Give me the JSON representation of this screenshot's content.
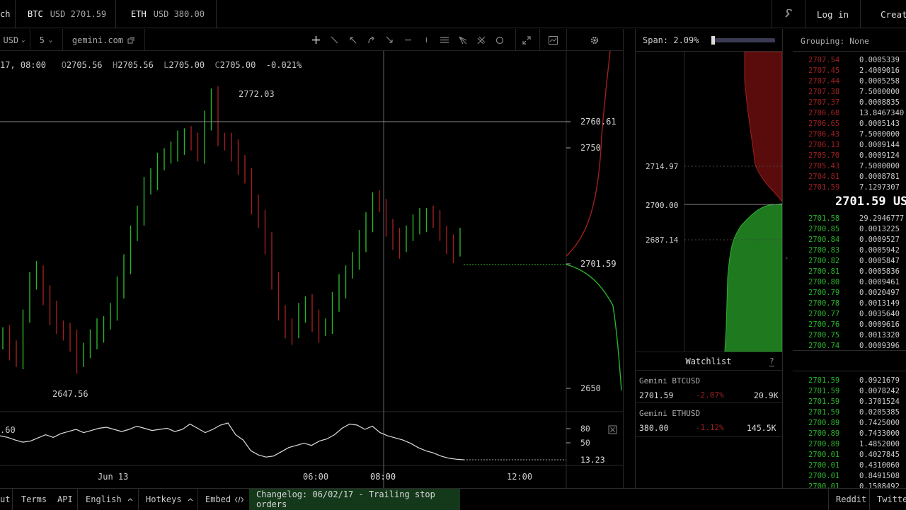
{
  "topbar": {
    "left_fragment": "ch",
    "tickers": [
      {
        "symbol": "BTC",
        "price": "USD 2701.59"
      },
      {
        "symbol": "ETH",
        "price": "USD 380.00"
      }
    ],
    "login": "Log in",
    "create": "Create"
  },
  "toolbar": {
    "pair_fragment": "USD",
    "interval": "5",
    "source": "gemini.com",
    "chevron": "⌄"
  },
  "ohlc": {
    "date": "17, 08:00",
    "open_label": "O",
    "open": "2705.56",
    "high_label": "H",
    "high": "2705.56",
    "low_label": "L",
    "low": "2705.00",
    "close_label": "C",
    "close": "2705.00",
    "change": "-0.021%"
  },
  "chart_data": {
    "type": "candlestick",
    "title": "",
    "x_ticks": [
      "Jun 13",
      "06:00",
      "08:00",
      "12:00"
    ],
    "y_ticks": [
      "2750",
      "2650"
    ],
    "y_range": [
      2630,
      2790
    ],
    "crosshair_price": "2760.61",
    "last_price": "2701.59",
    "high_marker": "2772.03",
    "low_marker": "2647.56",
    "closes": [
      2662,
      2654,
      2652,
      2670,
      2686,
      2690,
      2680,
      2672,
      2665,
      2663,
      2659,
      2650,
      2655,
      2660,
      2664,
      2667,
      2672,
      2683,
      2695,
      2707,
      2715,
      2730,
      2733,
      2739,
      2743,
      2745,
      2749,
      2752,
      2748,
      2744,
      2760,
      2769,
      2750,
      2749,
      2745,
      2740,
      2733,
      2720,
      2715,
      2704,
      2685,
      2672,
      2665,
      2663,
      2671,
      2676,
      2668,
      2664,
      2666,
      2677,
      2684,
      2690,
      2695,
      2704,
      2714,
      2722,
      2720,
      2710,
      2705,
      2702,
      2708,
      2712,
      2714,
      2716,
      2713,
      2708,
      2703,
      2700,
      2705
    ],
    "indicator": {
      "value_fragment": ".60",
      "ticks": [
        "80",
        "50"
      ],
      "last": "13.23",
      "values": [
        58,
        55,
        50,
        46,
        48,
        54,
        60,
        55,
        62,
        66,
        70,
        64,
        68,
        72,
        74,
        70,
        66,
        70,
        76,
        72,
        68,
        70,
        72,
        66,
        70,
        80,
        72,
        64,
        70,
        78,
        82,
        60,
        50,
        30,
        22,
        18,
        20,
        28,
        36,
        40,
        44,
        40,
        48,
        52,
        60,
        72,
        80,
        78,
        70,
        76,
        64,
        58,
        54,
        50,
        44,
        36,
        30,
        26,
        20,
        16,
        14,
        13
      ]
    }
  },
  "depth": {
    "span": "Span: 2.09%",
    "span_fraction": 0.05,
    "prices": [
      "2714.97",
      "2700.00",
      "2687.14"
    ]
  },
  "orderbook": {
    "grouping": "Grouping: None",
    "last_price": "2701.59 US",
    "asks": [
      {
        "price": "2707.54",
        "size": "0.0005339"
      },
      {
        "price": "2707.45",
        "size": "2.4009016"
      },
      {
        "price": "2707.44",
        "size": "0.0005258"
      },
      {
        "price": "2707.38",
        "size": "7.5000000"
      },
      {
        "price": "2707.37",
        "size": "0.0008835"
      },
      {
        "price": "2706.68",
        "size": "13.8467340"
      },
      {
        "price": "2706.65",
        "size": "0.0005143"
      },
      {
        "price": "2706.43",
        "size": "7.5000000"
      },
      {
        "price": "2706.13",
        "size": "0.0009144"
      },
      {
        "price": "2705.70",
        "size": "0.0009124"
      },
      {
        "price": "2705.43",
        "size": "7.5000000"
      },
      {
        "price": "2704.81",
        "size": "0.0008781"
      },
      {
        "price": "2701.59",
        "size": "7.1297307"
      }
    ],
    "bids": [
      {
        "price": "2701.58",
        "size": "29.2946777"
      },
      {
        "price": "2700.85",
        "size": "0.0013225"
      },
      {
        "price": "2700.84",
        "size": "0.0009527"
      },
      {
        "price": "2700.83",
        "size": "0.0005942"
      },
      {
        "price": "2700.82",
        "size": "0.0005847"
      },
      {
        "price": "2700.81",
        "size": "0.0005836"
      },
      {
        "price": "2700.80",
        "size": "0.0009461"
      },
      {
        "price": "2700.79",
        "size": "0.0020497"
      },
      {
        "price": "2700.78",
        "size": "0.0013149"
      },
      {
        "price": "2700.77",
        "size": "0.0035640"
      },
      {
        "price": "2700.76",
        "size": "0.0009616"
      },
      {
        "price": "2700.75",
        "size": "0.0013320"
      },
      {
        "price": "2700.74",
        "size": "0.0009396"
      }
    ],
    "trades": [
      {
        "price": "2701.59",
        "size": "0.0921679"
      },
      {
        "price": "2701.59",
        "size": "0.0078242"
      },
      {
        "price": "2701.59",
        "size": "0.3701524"
      },
      {
        "price": "2701.59",
        "size": "0.0205385"
      },
      {
        "price": "2700.89",
        "size": "0.7425000"
      },
      {
        "price": "2700.89",
        "size": "0.7433000"
      },
      {
        "price": "2700.89",
        "size": "1.4852000"
      },
      {
        "price": "2700.01",
        "size": "0.4027845"
      },
      {
        "price": "2700.01",
        "size": "0.4310060"
      },
      {
        "price": "2700.01",
        "size": "0.8491508"
      },
      {
        "price": "2700.01",
        "size": "0.1508492"
      }
    ]
  },
  "watchlist": {
    "title": "Watchlist",
    "help": "?",
    "items": [
      {
        "name": "Gemini BTCUSD",
        "price": "2701.59",
        "change": "-2.07%",
        "volume": "20.9K"
      },
      {
        "name": "Gemini ETHUSD",
        "price": "380.00",
        "change": "-1.12%",
        "volume": "145.5K"
      }
    ]
  },
  "footer": {
    "fragment": "ut",
    "terms": "Terms",
    "api": "API",
    "language": "English",
    "hotkeys": "Hotkeys",
    "embed": "Embed",
    "changelog": "Changelog: 06/02/17 - Trailing stop orders",
    "reddit": "Reddit",
    "twitter": "Twitter"
  },
  "colors": {
    "up": "#2bb32b",
    "down": "#a02020",
    "bid_fill": "#1f7a1f",
    "ask_fill": "#5a0c0c"
  }
}
